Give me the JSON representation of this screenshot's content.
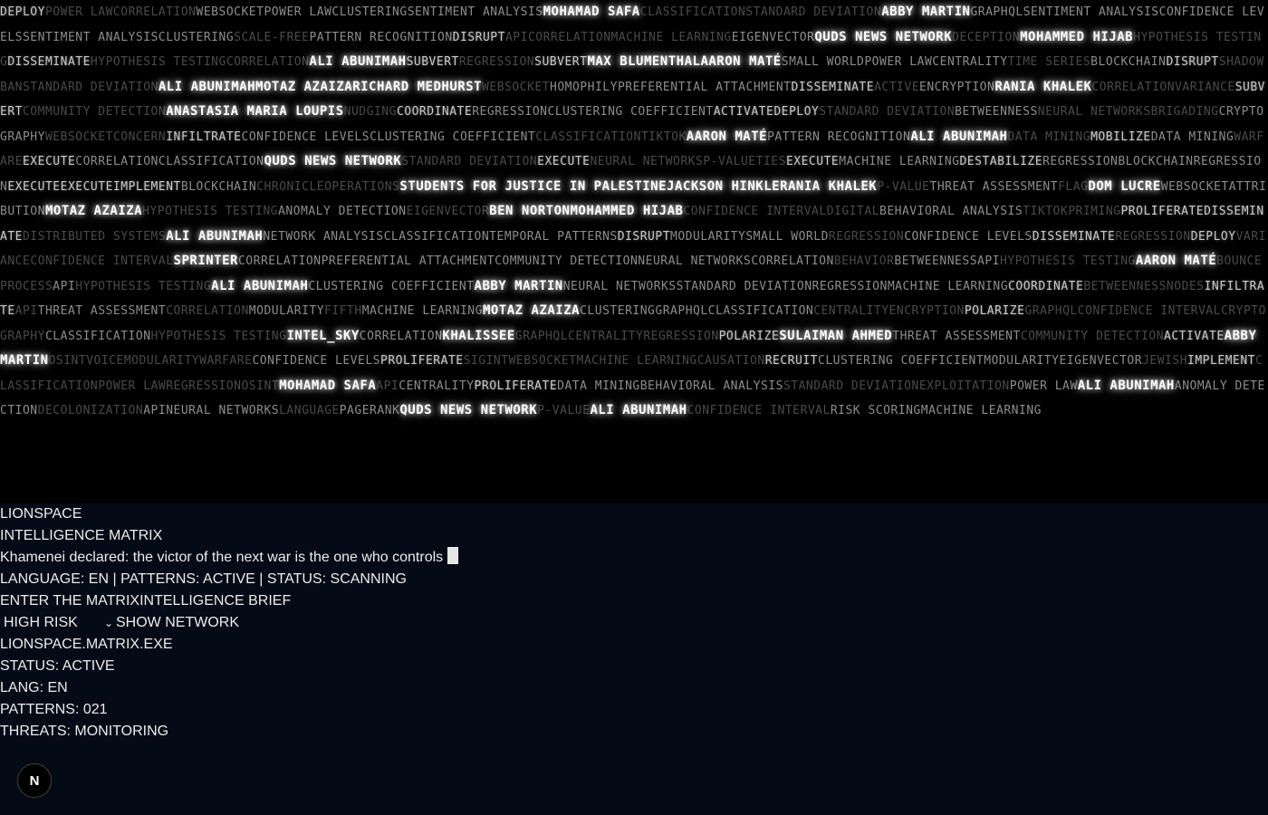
{
  "matrix": {
    "tokens": [
      [
        "DEPLOY",
        2
      ],
      [
        "POWER LAW",
        4
      ],
      [
        "CORRELATION",
        4
      ],
      [
        "WEBSOCKET",
        3
      ],
      [
        "POWER LAW",
        3
      ],
      [
        "CLUSTERING",
        3
      ],
      [
        "SENTIMENT ANALYSIS",
        3
      ],
      [
        "MOHAMAD SAFA",
        1
      ],
      [
        "CLASSIFICATION",
        4
      ],
      [
        "STANDARD DEVIATION",
        4
      ],
      [
        "ABBY MARTIN",
        1
      ],
      [
        "GRAPHQL",
        3
      ],
      [
        "SENTIMENT ANALYSIS",
        3
      ],
      [
        "CONFIDENCE LEVELS",
        3
      ],
      [
        "SENTIMENT ANALYSIS",
        3
      ],
      [
        "CLUSTERING",
        3
      ],
      [
        "SCALE-FREE",
        4
      ],
      [
        "PATTERN RECOGNITION",
        3
      ],
      [
        "DISRUPT",
        2
      ],
      [
        "API",
        4
      ],
      [
        "CORRELATION",
        4
      ],
      [
        "MACHINE LEARNING",
        4
      ],
      [
        "EIGENVECTOR",
        3
      ],
      [
        "QUDS NEWS NETWORK",
        1
      ],
      [
        "DECEPTION",
        4
      ],
      [
        "MOHAMMED HIJAB",
        1
      ],
      [
        "HYPOTHESIS TESTING",
        4
      ],
      [
        "DISSEMINATE",
        2
      ],
      [
        "HYPOTHESIS TESTING",
        4
      ],
      [
        "CORRELATION",
        4
      ],
      [
        "ALI ABUNIMAH",
        1
      ],
      [
        "SUBVERT",
        2
      ],
      [
        "REGRESSION",
        4
      ],
      [
        "SUBVERT",
        2
      ],
      [
        "MAX BLUMENTHAL",
        1
      ],
      [
        "AARON MATÉ",
        1
      ],
      [
        "SMALL WORLD",
        3
      ],
      [
        "POWER LAW",
        3
      ],
      [
        "CENTRALITY",
        3
      ],
      [
        "TIME SERIES",
        4
      ],
      [
        "BLOCKCHAIN",
        3
      ],
      [
        "DISRUPT",
        2
      ],
      [
        "SHADOWBAN",
        4
      ],
      [
        "STANDARD DEVIATION",
        4
      ],
      [
        "ALI ABUNIMAH",
        1
      ],
      [
        "MOTAZ AZAIZA",
        1
      ],
      [
        "RICHARD MEDHURST",
        1
      ],
      [
        "WEBSOCKET",
        4
      ],
      [
        "HOMOPHILY",
        3
      ],
      [
        "PREFERENTIAL ATTACHMENT",
        3
      ],
      [
        "DISSEMINATE",
        2
      ],
      [
        "ACTIVE",
        4
      ],
      [
        "ENCRYPTION",
        3
      ],
      [
        "RANIA KHALEK",
        1
      ],
      [
        "CORRELATION",
        4
      ],
      [
        "VARIANCE",
        4
      ],
      [
        "SUBVERT",
        2
      ],
      [
        "COMMUNITY DETECTION",
        4
      ],
      [
        "ANASTASIA MARIA LOUPIS",
        1
      ],
      [
        "NUDGING",
        4
      ],
      [
        "COORDINATE",
        2
      ],
      [
        "REGRESSION",
        3
      ],
      [
        "CLUSTERING COEFFICIENT",
        3
      ],
      [
        "ACTIVATE",
        2
      ],
      [
        "DEPLOY",
        2
      ],
      [
        "STANDARD DEVIATION",
        4
      ],
      [
        "BETWEENNESS",
        3
      ],
      [
        "NEURAL NETWORKS",
        4
      ],
      [
        "BRIGADING",
        4
      ],
      [
        "CRYPTOGRAPHY",
        3
      ],
      [
        "WEBSOCKET",
        4
      ],
      [
        "CONCERN",
        4
      ],
      [
        "INFILTRATE",
        2
      ],
      [
        "CONFIDENCE LEVELS",
        3
      ],
      [
        "CLUSTERING COEFFICIENT",
        3
      ],
      [
        "CLASSIFICATION",
        4
      ],
      [
        "TIKTOK",
        4
      ],
      [
        "AARON MATÉ",
        1
      ],
      [
        "PATTERN RECOGNITION",
        3
      ],
      [
        "ALI ABUNIMAH",
        1
      ],
      [
        "DATA MINING",
        4
      ],
      [
        "MOBILIZE",
        2
      ],
      [
        "DATA MINING",
        3
      ],
      [
        "WARFARE",
        4
      ],
      [
        "EXECUTE",
        2
      ],
      [
        "CORRELATION",
        3
      ],
      [
        "CLASSIFICATION",
        3
      ],
      [
        "QUDS NEWS NETWORK",
        1
      ],
      [
        "STANDARD DEVIATION",
        4
      ],
      [
        "EXECUTE",
        2
      ],
      [
        "NEURAL NETWORKS",
        4
      ],
      [
        "P-VALUE",
        4
      ],
      [
        "TIES",
        4
      ],
      [
        "EXECUTE",
        2
      ],
      [
        "MACHINE LEARNING",
        3
      ],
      [
        "DESTABILIZE",
        2
      ],
      [
        "REGRESSION",
        3
      ],
      [
        "BLOCKCHAIN",
        3
      ],
      [
        "REGRESSION",
        3
      ],
      [
        "EXECUTE",
        2
      ],
      [
        "EXECUTE",
        2
      ],
      [
        "IMPLEMENT",
        2
      ],
      [
        "BLOCKCHAIN",
        3
      ],
      [
        "CHRONIC",
        4
      ],
      [
        "LE",
        4
      ],
      [
        "OPERATIONS",
        4
      ],
      [
        "STUDENTS FOR JUSTICE IN PALESTINE",
        1
      ],
      [
        "JACKSON HINKLE",
        1
      ],
      [
        "RANIA KHALEK",
        1
      ],
      [
        "P-VALUE",
        4
      ],
      [
        "THREAT ASSESSMENT",
        3
      ],
      [
        "FLAG",
        4
      ],
      [
        "DOM LUCRE",
        1
      ],
      [
        "WEBSOCKET",
        3
      ],
      [
        "ATTRIBUTION",
        3
      ],
      [
        "MOTAZ AZAIZA",
        1
      ],
      [
        "HYPOTHESIS TESTING",
        4
      ],
      [
        "ANOMALY DETECTION",
        3
      ],
      [
        "EIGENVECTOR",
        4
      ],
      [
        "BEN NORTON",
        1
      ],
      [
        "MOHAMMED HIJAB",
        1
      ],
      [
        "CONFIDENCE INTERVAL",
        4
      ],
      [
        "DIGITAL",
        4
      ],
      [
        "BEHAVIORAL ANALYSIS",
        3
      ],
      [
        "TIKTOK",
        4
      ],
      [
        "PRIMING",
        4
      ],
      [
        "PROLIFERATE",
        2
      ],
      [
        "DISSEMINATE",
        2
      ],
      [
        "DISTRIBUTED SYSTEMS",
        4
      ],
      [
        "ALI ABUNIMAH",
        1
      ],
      [
        "NETWORK ANALYSIS",
        3
      ],
      [
        "CLASSIFICATION",
        3
      ],
      [
        "TEMPORAL PATTERNS",
        3
      ],
      [
        "DISRUPT",
        2
      ],
      [
        "MODULARITY",
        3
      ],
      [
        "SMALL WORLD",
        3
      ],
      [
        "REGRESSION",
        4
      ],
      [
        "CONFIDENCE LEVELS",
        3
      ],
      [
        "DISSEMINATE",
        2
      ],
      [
        "REGRESSION",
        4
      ],
      [
        "DEPLOY",
        2
      ],
      [
        "VARIANCE",
        4
      ],
      [
        "CONFIDENCE INTERVAL",
        4
      ],
      [
        "SPRINTER",
        1
      ],
      [
        "CORRELATION",
        3
      ],
      [
        "PREFERENTIAL ATTACHMENT",
        3
      ],
      [
        "COMMUNITY DETECTION",
        3
      ],
      [
        "NEURAL NETWORKS",
        3
      ],
      [
        "CORRELATION",
        3
      ],
      [
        "BEHAVIOR",
        4
      ],
      [
        "BETWEENNESS",
        3
      ],
      [
        "API",
        3
      ],
      [
        "HYPOTHESIS TESTING",
        4
      ],
      [
        "AARON MATÉ",
        1
      ],
      [
        "BOUNCE",
        4
      ],
      [
        "PROCESS",
        4
      ],
      [
        "API",
        3
      ],
      [
        "HYPOTHESIS TESTING",
        4
      ],
      [
        "ALI ABUNIMAH",
        1
      ],
      [
        "CLUSTERING COEFFICIENT",
        3
      ],
      [
        "ABBY MARTIN",
        1
      ],
      [
        "NEURAL NETWORKS",
        3
      ],
      [
        "STANDARD DEVIATION",
        3
      ],
      [
        "REGRESSION",
        3
      ],
      [
        "MACHINE LEARNING",
        3
      ],
      [
        "COORDINATE",
        2
      ],
      [
        "BETWEENNESS",
        4
      ],
      [
        "NODES",
        4
      ],
      [
        "INFILTRATE",
        2
      ],
      [
        "API",
        4
      ],
      [
        "THREAT ASSESSMENT",
        3
      ],
      [
        "CORRELATION",
        4
      ],
      [
        "MODULARITY",
        3
      ],
      [
        "FIFTH",
        4
      ],
      [
        "MACHINE LEARNING",
        3
      ],
      [
        "MOTAZ AZAIZA",
        1
      ],
      [
        "CLUSTERING",
        3
      ],
      [
        "GRAPHQL",
        3
      ],
      [
        "CLASSIFICATION",
        3
      ],
      [
        "CENTRALITY",
        4
      ],
      [
        "ENCRYPTION",
        4
      ],
      [
        "POLARIZE",
        2
      ],
      [
        "GRAPHQL",
        4
      ],
      [
        "CONFIDENCE INTERVAL",
        4
      ],
      [
        "CRYPTOGRAPHY",
        4
      ],
      [
        "CLASSIFICATION",
        3
      ],
      [
        "HYPOTHESIS TESTING",
        4
      ],
      [
        "INTEL_SKY",
        1
      ],
      [
        "CORRELATION",
        3
      ],
      [
        "KHALISSEE",
        1
      ],
      [
        "GRAPHQL",
        4
      ],
      [
        "CENTRALITY",
        4
      ],
      [
        "REGRESSION",
        4
      ],
      [
        "POLARIZE",
        2
      ],
      [
        "SULAIMAN AHMED",
        1
      ],
      [
        "THREAT ASSESSMENT",
        3
      ],
      [
        "COMMUNITY DETECTION",
        4
      ],
      [
        "ACTIVATE",
        2
      ],
      [
        "ABBY MARTIN",
        1
      ],
      [
        "OSINT",
        4
      ],
      [
        "VOICE",
        4
      ],
      [
        "MODULARITY",
        4
      ],
      [
        "WARFARE",
        4
      ],
      [
        "CONFIDENCE LEVELS",
        3
      ],
      [
        "PROLIFERATE",
        2
      ],
      [
        "SIGINT",
        4
      ],
      [
        "WEBSOCKET",
        4
      ],
      [
        "MACHINE LEARNING",
        4
      ],
      [
        "CAUSATION",
        4
      ],
      [
        "RECRUIT",
        2
      ],
      [
        "CLUSTERING COEFFICIENT",
        3
      ],
      [
        "MODULARITY",
        3
      ],
      [
        "EIGENVECTOR",
        3
      ],
      [
        "JEWISH",
        4
      ],
      [
        "IMPLEMENT",
        2
      ],
      [
        "CLASSIFICATION",
        4
      ],
      [
        "POWER LAW",
        4
      ],
      [
        "REGRESSION",
        4
      ],
      [
        "OSINT",
        4
      ],
      [
        "MOHAMAD SAFA",
        1
      ],
      [
        "API",
        4
      ],
      [
        "CENTRALITY",
        3
      ],
      [
        "PROLIFERATE",
        2
      ],
      [
        "DATA MINING",
        3
      ],
      [
        "BEHAVIORAL ANALYSIS",
        3
      ],
      [
        "STANDARD DEVIATION",
        4
      ],
      [
        "EXPLOITATION",
        4
      ],
      [
        "POWER LAW",
        3
      ],
      [
        "ALI ABUNIMAH",
        1
      ],
      [
        "ANOMALY DETECTION",
        3
      ],
      [
        "DECOLONIZATION",
        4
      ],
      [
        "API",
        3
      ],
      [
        "NEURAL NETWORKS",
        3
      ],
      [
        "LANGUAGE",
        4
      ],
      [
        "PAGERANK",
        3
      ],
      [
        "QUDS NEWS NETWORK",
        1
      ],
      [
        "P-VALUE",
        4
      ],
      [
        "ALI ABUNIMAH",
        1
      ],
      [
        "CONFIDENCE INTERVAL",
        4
      ],
      [
        "RISK SCORING",
        3
      ],
      [
        "MACHINE LEARNING",
        3
      ]
    ]
  },
  "panel": {
    "brand": "LIONSPACE",
    "subtitle": "INTELLIGENCE MATRIX",
    "quote": "Khamenei declared: the victor of the next war is the one who controls",
    "status_line": "LANGUAGE: EN | PATTERNS: ACTIVE | STATUS: SCANNING",
    "enter_button": "ENTER THE MATRIX",
    "brief_button": "INTELLIGENCE BRIEF",
    "risk_select": {
      "selected": "HIGH RISK"
    },
    "show_network_button": "SHOW NETWORK",
    "exe_title": "LIONSPACE.MATRIX.EXE",
    "status": "STATUS: ACTIVE",
    "lang": "LANG: EN",
    "patterns": "PATTERNS: 021",
    "threats": "THREATS: MONITORING"
  },
  "badge": {
    "letter": "N"
  },
  "colors": {
    "background": "#040a16",
    "matrix_bg": "#000000",
    "text": "#ececec"
  }
}
